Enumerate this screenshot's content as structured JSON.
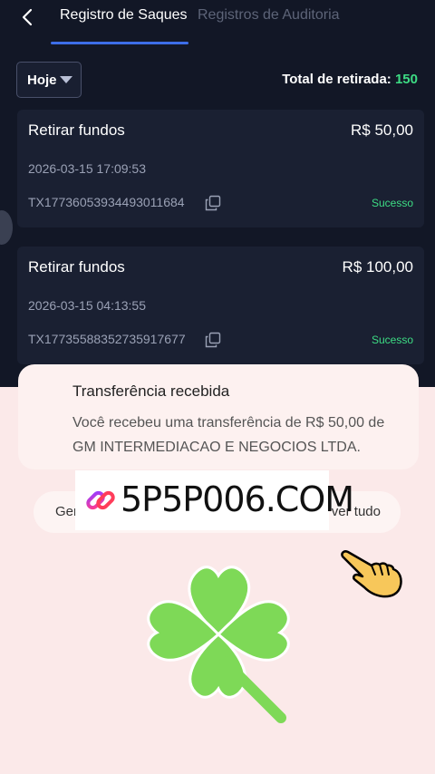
{
  "header": {
    "tabs": [
      {
        "label": "Registro de Saques",
        "active": true
      },
      {
        "label": "Registros de Auditoria",
        "active": false
      }
    ]
  },
  "filter": {
    "selected": "Hoje"
  },
  "total": {
    "label": "Total de retirada: ",
    "value": "150"
  },
  "withdrawals": [
    {
      "title": "Retirar fundos",
      "amount": "R$ 50,00",
      "date": "2026-03-15 17:09:53",
      "tx": "TX17736053934493011684",
      "status": "Sucesso"
    },
    {
      "title": "Retirar fundos",
      "amount": "R$ 100,00",
      "date": "2026-03-15 04:13:55",
      "tx": "TX17735588352735917677",
      "status": "Sucesso"
    }
  ],
  "notification": {
    "title": "Transferência recebida",
    "body": "Você recebeu uma transferência de R$ 50,00 de GM INTERMEDIACAO E NEGOCIOS LTDA."
  },
  "pill": {
    "left": "Ger",
    "right": "ver tudo"
  },
  "banner": {
    "text": "5P5P006.COM"
  },
  "icons": {
    "back": "chevron-left-icon",
    "copy": "copy-icon",
    "link": "link-icon",
    "hand": "pointing-hand-icon",
    "clover": "four-leaf-clover-icon"
  },
  "colors": {
    "app_bg": "#121726",
    "card_bg": "#1a2032",
    "accent": "#3d6ee8",
    "success": "#3ddc84",
    "clover": "#7ed957"
  }
}
